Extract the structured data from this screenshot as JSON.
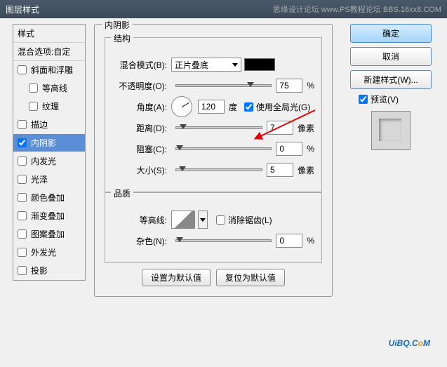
{
  "titlebar": {
    "title": "图层样式",
    "right": "思缘设计论坛  www.PS教程论坛  BBS.16xx8.COM"
  },
  "styles": {
    "header": "样式",
    "blend": "混合选项:自定",
    "items": [
      {
        "label": "斜面和浮雕",
        "checked": false
      },
      {
        "label": "等高线",
        "checked": false,
        "indent": true
      },
      {
        "label": "纹理",
        "checked": false,
        "indent": true
      },
      {
        "label": "描边",
        "checked": false
      },
      {
        "label": "内阴影",
        "checked": true,
        "selected": true
      },
      {
        "label": "内发光",
        "checked": false
      },
      {
        "label": "光泽",
        "checked": false
      },
      {
        "label": "颜色叠加",
        "checked": false
      },
      {
        "label": "渐变叠加",
        "checked": false
      },
      {
        "label": "图案叠加",
        "checked": false
      },
      {
        "label": "外发光",
        "checked": false
      },
      {
        "label": "投影",
        "checked": false
      }
    ]
  },
  "panel": {
    "title": "内阴影",
    "structure": {
      "title": "结构",
      "blendMode": {
        "label": "混合模式(B):",
        "value": "正片叠底"
      },
      "opacity": {
        "label": "不透明度(O):",
        "value": "75",
        "unit": "%"
      },
      "angle": {
        "label": "角度(A):",
        "value": "120",
        "unit": "度",
        "globalLabel": "使用全局光(G)",
        "globalChecked": true
      },
      "distance": {
        "label": "距离(D):",
        "value": "7",
        "unit": "像素"
      },
      "choke": {
        "label": "阻塞(C):",
        "value": "0",
        "unit": "%"
      },
      "size": {
        "label": "大小(S):",
        "value": "5",
        "unit": "像素"
      }
    },
    "quality": {
      "title": "品质",
      "contour": {
        "label": "等高线:",
        "antiAlias": "消除锯齿(L)",
        "antiChecked": false
      },
      "noise": {
        "label": "杂色(N):",
        "value": "0",
        "unit": "%"
      }
    },
    "buttons": {
      "default": "设置为默认值",
      "reset": "复位为默认值"
    }
  },
  "right": {
    "ok": "确定",
    "cancel": "取消",
    "newStyle": "新建样式(W)...",
    "preview": "预览(V)"
  },
  "watermark": {
    "a": "UiBQ.C",
    "b": "o",
    "c": "M"
  }
}
